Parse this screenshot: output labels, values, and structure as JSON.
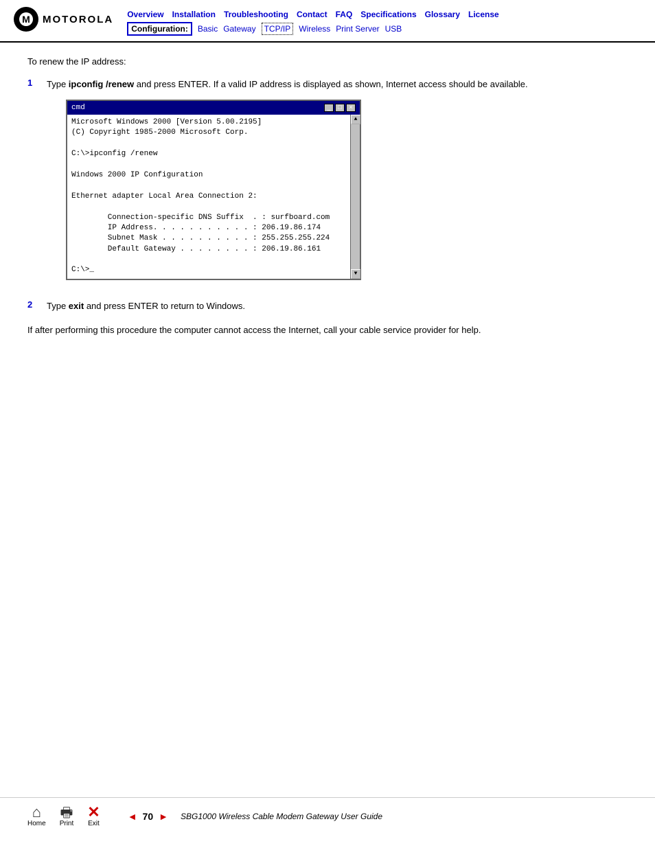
{
  "header": {
    "logo_text": "MOTOROLA",
    "nav_links": [
      {
        "label": "Overview",
        "id": "overview"
      },
      {
        "label": "Installation",
        "id": "installation"
      },
      {
        "label": "Troubleshooting",
        "id": "troubleshooting"
      },
      {
        "label": "Contact",
        "id": "contact"
      },
      {
        "label": "FAQ",
        "id": "faq"
      },
      {
        "label": "Specifications",
        "id": "specifications"
      },
      {
        "label": "Glossary",
        "id": "glossary"
      },
      {
        "label": "License",
        "id": "license"
      }
    ],
    "config_label": "Configuration:",
    "config_links": [
      {
        "label": "Basic",
        "id": "basic"
      },
      {
        "label": "Gateway",
        "id": "gateway"
      },
      {
        "label": "TCP/IP",
        "id": "tcpip",
        "active": true
      },
      {
        "label": "Wireless",
        "id": "wireless"
      },
      {
        "label": "Print Server",
        "id": "print-server"
      },
      {
        "label": "USB",
        "id": "usb"
      }
    ]
  },
  "content": {
    "intro": "To renew the IP address:",
    "steps": [
      {
        "number": "1",
        "text_before": "Type ",
        "cmd_bold": "ipconfig /renew",
        "text_after": " and press ENTER. If a valid IP address is displayed as shown, Internet access should be available."
      },
      {
        "number": "2",
        "text_before": "Type ",
        "cmd_bold": "exit",
        "text_after": " and press ENTER to return to Windows."
      }
    ],
    "footer_text": "If after performing this procedure the computer cannot access the Internet, call your cable service provider for help.",
    "cmd_window": {
      "title": "cmd",
      "titlebar_buttons": [
        "-",
        "□",
        "×"
      ],
      "lines": [
        "Microsoft Windows 2000 [Version 5.00.2195]",
        "(C) Copyright 1985-2000 Microsoft Corp.",
        "",
        "C:\\>ipconfig /renew",
        "",
        "Windows 2000 IP Configuration",
        "",
        "Ethernet adapter Local Area Connection 2:",
        "",
        "        Connection-specific DNS Suffix  . : surfboard.com",
        "        IP Address. . . . . . . . . . . : 206.19.86.174",
        "        Subnet Mask . . . . . . . . . . : 255.255.255.224",
        "        Default Gateway . . . . . . . . : 206.19.86.161",
        "",
        "C:\\>_"
      ]
    }
  },
  "footer": {
    "home_label": "Home",
    "print_label": "Print",
    "exit_label": "Exit",
    "prev_arrow": "◄",
    "page_number": "70",
    "next_arrow": "►",
    "guide_text": "SBG1000 Wireless Cable Modem Gateway User Guide"
  }
}
